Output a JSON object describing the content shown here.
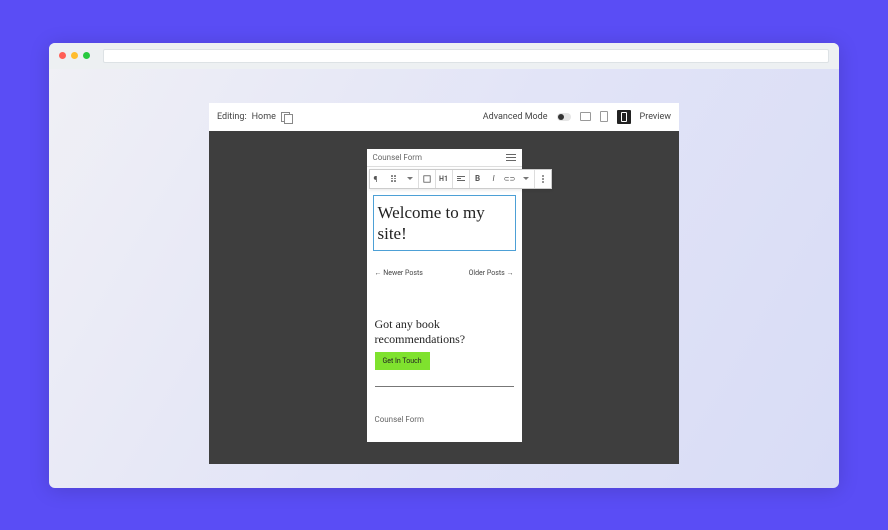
{
  "toolbar": {
    "editing_label": "Editing:",
    "page_name": "Home",
    "advanced_label": "Advanced Mode",
    "preview_label": "Preview"
  },
  "block_toolbar": {
    "heading_level": "H1",
    "bold": "B",
    "italic": "I",
    "link": "⊂⊃"
  },
  "page": {
    "site_title": "Counsel Form",
    "heading_text": "Welcome to my site!",
    "nav_prev": "← Newer Posts",
    "nav_next": "Older Posts →",
    "footer_heading": "Got any book recommendations?",
    "cta_label": "Get In Touch",
    "footer_brand": "Counsel Form"
  },
  "colors": {
    "page_bg": "#5a4df5",
    "canvas_bg": "#3e3e3e",
    "selection": "#4da0d6",
    "cta": "#7fe22e"
  }
}
